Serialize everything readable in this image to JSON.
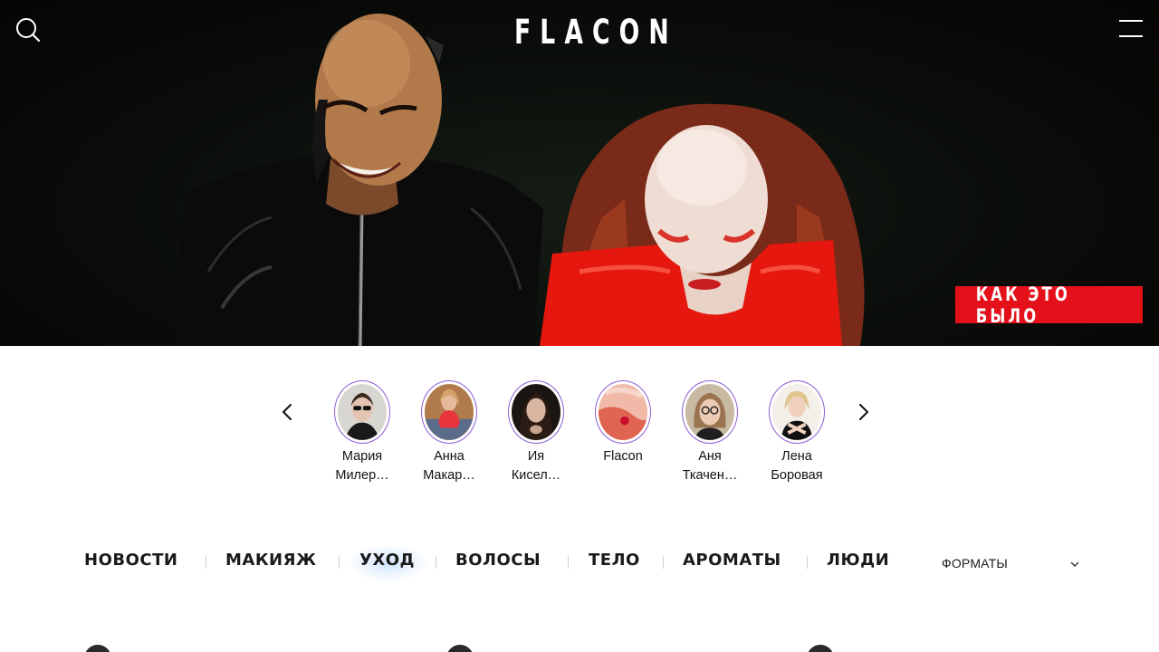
{
  "header": {
    "logo": "FLACON",
    "search_icon": "search-icon",
    "menu_icon": "hamburger-menu-icon"
  },
  "hero": {
    "tag": "КАК ЭТО БЫЛО",
    "tag_color": "#e4111b"
  },
  "stories": {
    "prev_icon": "chevron-left-icon",
    "next_icon": "chevron-right-icon",
    "ring_color": "#8d5fd3",
    "items": [
      {
        "line1": "Мария",
        "line2": "Милер…"
      },
      {
        "line1": "Анна",
        "line2": "Макар…"
      },
      {
        "line1": "Ия",
        "line2": "Кисел…"
      },
      {
        "line1": "Flacon",
        "line2": ""
      },
      {
        "line1": "Аня",
        "line2": "Ткачен…"
      },
      {
        "line1": "Лена",
        "line2": "Боровая"
      }
    ]
  },
  "categories": {
    "items": [
      "НОВОСТИ",
      "МАКИЯЖ",
      "УХОД",
      "ВОЛОСЫ",
      "ТЕЛО",
      "АРОМАТЫ",
      "ЛЮДИ"
    ],
    "active": "УХОД",
    "formats_label": "ФОРМАТЫ",
    "formats_icon": "chevron-down-icon"
  }
}
